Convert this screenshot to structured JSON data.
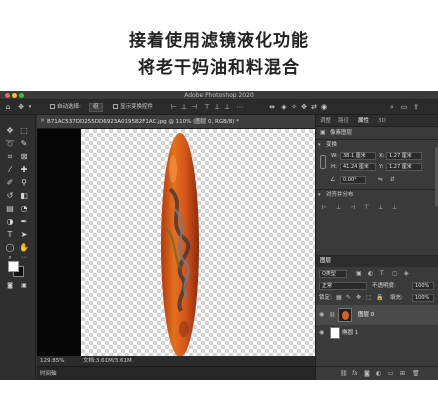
{
  "caption": {
    "line1": "接着使用滤镜液化功能",
    "line2": "将老干妈油和料混合"
  },
  "app": {
    "window_title": "Adobe Photoshop 2020",
    "traffic_lights": [
      "#fe5f57",
      "#febc2e",
      "#28c840"
    ]
  },
  "options_bar": {
    "auto_select_label": "自动选择:",
    "auto_select_value": "组",
    "show_transform_label": "显示变换控件"
  },
  "document": {
    "tab_title": "B71AC537DD255DD6923A0195B2F1AC.jpg @ 110% (图层 0, RGB/8) *",
    "zoom": "129.85%",
    "doc_size": "文档:3.61M/3.61M",
    "timeline_label": "时间轴"
  },
  "properties_panel": {
    "tabs": [
      "调整",
      "路径",
      "属性",
      "3D"
    ],
    "active_tab": "属性",
    "pixel_layer_label": "像素图层",
    "transform_label": "变换",
    "w_label": "W:",
    "w_value": "38.1 厘米",
    "x_label": "X:",
    "x_value": "1.27 厘米",
    "h_label": "H:",
    "h_value": "41.24 厘米",
    "y_label": "Y:",
    "y_value": "1.27 厘米",
    "angle_value": "0.00°",
    "align_label": "对齐并分布"
  },
  "layers_panel": {
    "title": "图层",
    "filter_label": "Q类型",
    "blend_mode": "正常",
    "opacity_label": "不透明度:",
    "opacity_value": "100%",
    "lock_label": "锁定:",
    "fill_label": "填充:",
    "fill_value": "100%",
    "layers": [
      {
        "name": "图层 0",
        "selected": true
      },
      {
        "name": "椭圆 1",
        "selected": false
      }
    ]
  },
  "colors": {
    "app_bg": "#323232",
    "panel_bg": "#3a3a3a",
    "accent": "#e85a1c"
  }
}
